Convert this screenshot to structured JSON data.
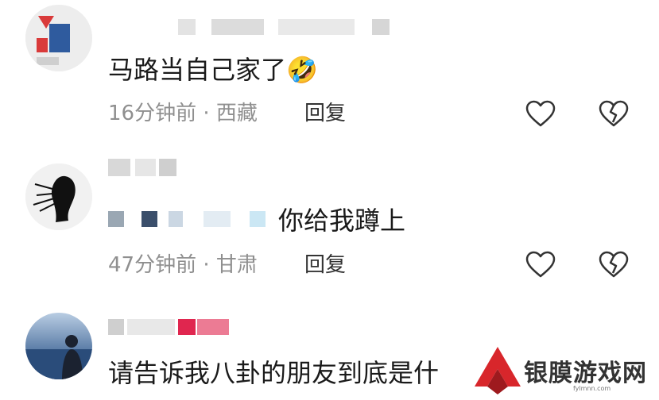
{
  "comments": [
    {
      "text": "马路当自己家了",
      "emoji": "🤣",
      "time": "16分钟前",
      "location": "西藏",
      "reply_label": "回复"
    },
    {
      "text": "你给我蹲上",
      "time": "47分钟前",
      "location": "甘肃",
      "reply_label": "回复"
    },
    {
      "text": "请告诉我八卦的朋友到底是什"
    }
  ],
  "meta_separator": " · ",
  "watermark": {
    "text": "银膜游戏网",
    "url": "fylmnn.com",
    "color": "#d8262b"
  },
  "icons": [
    "like-heart-icon",
    "dislike-broken-heart-icon",
    "watermark-logo-icon"
  ]
}
